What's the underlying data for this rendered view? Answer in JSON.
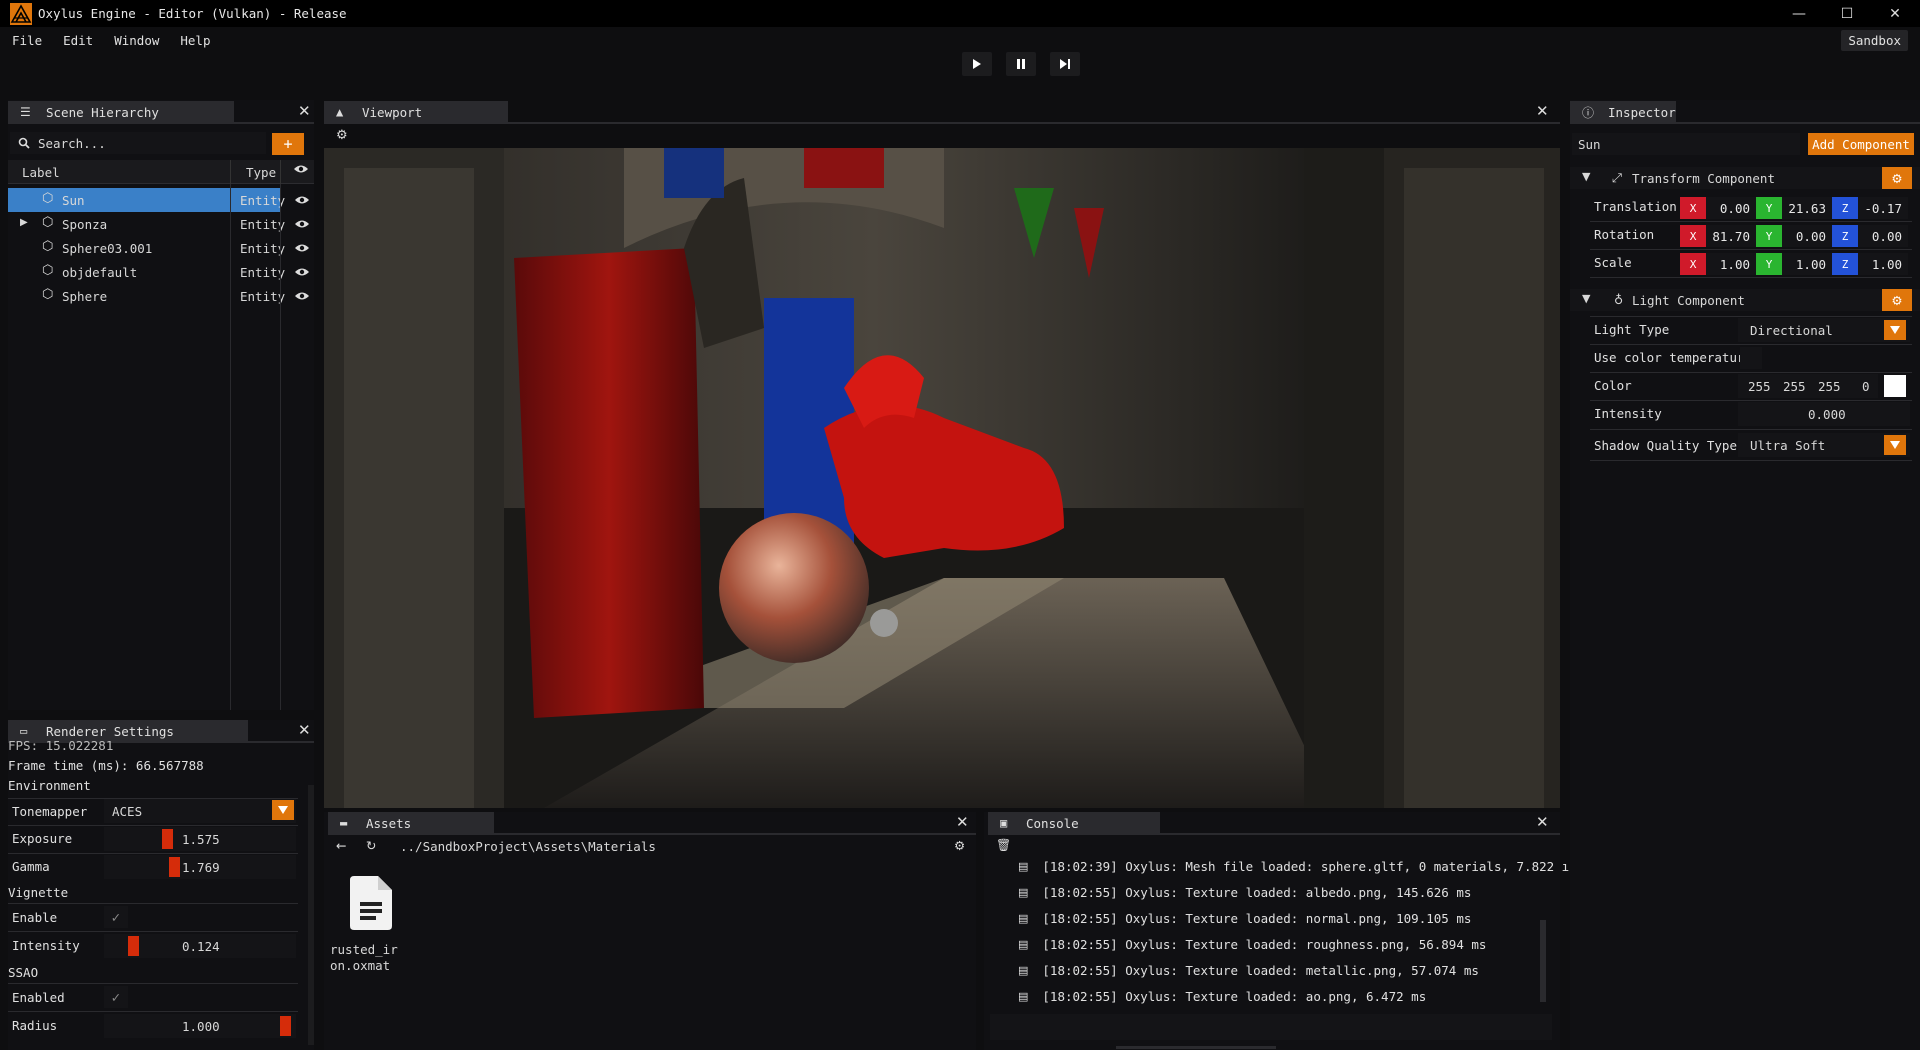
{
  "window": {
    "title": "Oxylus Engine - Editor (Vulkan) - Release",
    "minimize": "—",
    "maximize": "☐",
    "close": "✕"
  },
  "menu": [
    "File",
    "Edit",
    "Window",
    "Help"
  ],
  "project_button": "Sandbox",
  "scene_hierarchy": {
    "tab": "Scene Hierarchy",
    "search_placeholder": "Search...",
    "add": "+",
    "columns": [
      "Label",
      "Type"
    ],
    "rows": [
      {
        "label": "Sun",
        "type": "Entity",
        "selected": true,
        "expandable": false
      },
      {
        "label": "Sponza",
        "type": "Entity",
        "selected": false,
        "expandable": true
      },
      {
        "label": "Sphere03.001",
        "type": "Entity",
        "selected": false,
        "expandable": false
      },
      {
        "label": "objdefault",
        "type": "Entity",
        "selected": false,
        "expandable": false
      },
      {
        "label": "Sphere",
        "type": "Entity",
        "selected": false,
        "expandable": false
      }
    ]
  },
  "renderer_settings": {
    "tab": "Renderer Settings",
    "fps": "FPS: 15.022281",
    "frame_time": "Frame time (ms): 66.567788",
    "environment": "Environment",
    "tonemapper_label": "Tonemapper",
    "tonemapper_value": "ACES",
    "exposure_label": "Exposure",
    "exposure_value": "1.575",
    "gamma_label": "Gamma",
    "gamma_value": "1.769",
    "vignette": "Vignette",
    "enable_label": "Enable",
    "intensity_label": "Intensity",
    "intensity_value": "0.124",
    "ssao": "SSAO",
    "enabled_label": "Enabled",
    "radius_label": "Radius",
    "radius_value": "1.000"
  },
  "viewport": {
    "tab": "Viewport"
  },
  "inspector": {
    "tab": "Inspector",
    "name": "Sun",
    "add_component": "Add Component",
    "transform": {
      "title": "Transform Component",
      "rows": [
        {
          "label": "Translation",
          "x": "0.00",
          "y": "21.63",
          "z": "-0.17"
        },
        {
          "label": "Rotation",
          "x": "81.70",
          "y": "0.00",
          "z": "0.00"
        },
        {
          "label": "Scale",
          "x": "1.00",
          "y": "1.00",
          "z": "1.00"
        }
      ]
    },
    "light": {
      "title": "Light Component",
      "light_type_label": "Light Type",
      "light_type_value": "Directional",
      "color_temp_label": "Use color temperature",
      "color_label": "Color",
      "color_r": "255",
      "color_g": "255",
      "color_b": "255",
      "color_a": "0",
      "intensity_label": "Intensity",
      "intensity_value": "0.000",
      "shadow_label": "Shadow Quality Type",
      "shadow_value": "Ultra Soft"
    }
  },
  "assets": {
    "tab": "Assets",
    "path": "../SandboxProject\\Assets\\Materials",
    "file_line1": "rusted_ir",
    "file_line2": "on.oxmat"
  },
  "console": {
    "tab": "Console",
    "lines": [
      "[18:02:39] Oxylus: Mesh file loaded: sphere.gltf, 0 materials, 7.822 ı",
      "[18:02:55] Oxylus: Texture loaded: albedo.png, 145.626 ms",
      "[18:02:55] Oxylus: Texture loaded: normal.png, 109.105 ms",
      "[18:02:55] Oxylus: Texture loaded: roughness.png, 56.894 ms",
      "[18:02:55] Oxylus: Texture loaded: metallic.png, 57.074 ms",
      "[18:02:55] Oxylus: Texture loaded: ao.png, 6.472 ms"
    ]
  },
  "colors": {
    "accent": "#e0760b",
    "selection": "#3a80c8",
    "x": "#d01a2a",
    "y": "#2ab530",
    "z": "#2352d8"
  }
}
